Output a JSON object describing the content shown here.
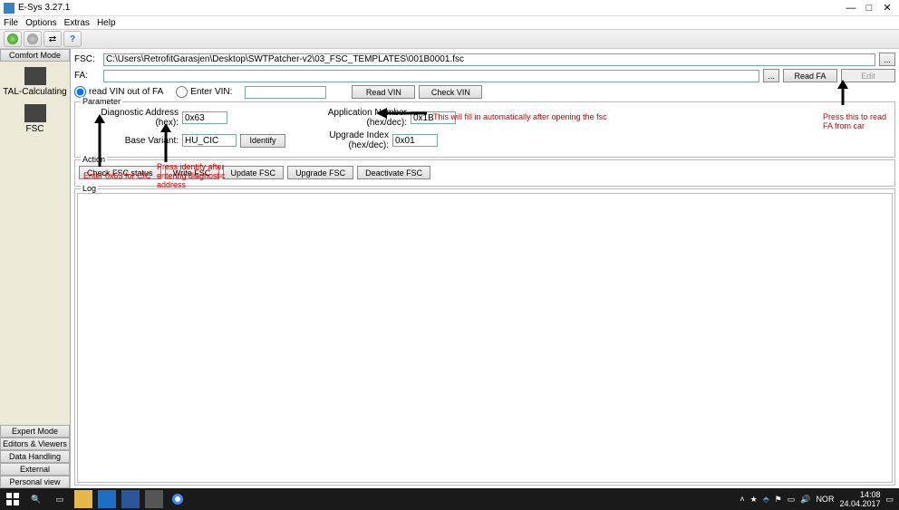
{
  "title": "E-Sys 3.27.1",
  "menubar": [
    "File",
    "Options",
    "Extras",
    "Help"
  ],
  "sidebar": {
    "top_header": "Comfort Mode",
    "items": [
      {
        "label": "TAL-Calculating"
      },
      {
        "label": "FSC"
      }
    ],
    "footer": [
      "Expert Mode",
      "Editors & Viewers",
      "Data Handling",
      "External Applications",
      "Personal view"
    ]
  },
  "fsc": {
    "label": "FSC:",
    "path": "C:\\Users\\RetrofitGarasjen\\Desktop\\SWTPatcher-v2\\03_FSC_TEMPLATES\\001B0001.fsc",
    "browse": "..."
  },
  "fa": {
    "label": "FA:",
    "value": "",
    "browse": "...",
    "read_btn": "Read FA",
    "edit_btn": "Edit"
  },
  "vin": {
    "radio_outfa": "read VIN out of FA",
    "radio_enter": "Enter VIN:",
    "enter_value": "",
    "read_btn": "Read VIN",
    "check_btn": "Check VIN"
  },
  "parameter": {
    "legend": "Parameter",
    "diag_label": "Diagnostic Address (hex):",
    "diag_value": "0x63",
    "app_label": "Application Number (hex/dec):",
    "app_value": "0x1B",
    "base_label": "Base Variant:",
    "base_value": "HU_CIC",
    "identify_btn": "Identify",
    "upgrade_label": "Upgrade Index (hex/dec):",
    "upgrade_value": "0x01"
  },
  "action": {
    "legend": "Action",
    "buttons": [
      "Check FSC status",
      "Write FSC",
      "Update FSC",
      "Upgrade FSC",
      "Deactivate FSC"
    ]
  },
  "log": {
    "legend": "Log"
  },
  "annotations": {
    "fillauto": "This will fill in automatically after opening the fsc",
    "pressread": "Press this to read FA from car",
    "enter63": "Enter 0x63 for CIC",
    "pressidentify": "Press identify after entering diagnostic address"
  },
  "taskbar": {
    "tray_text": "NOR",
    "time": "14:08",
    "date": "24.04.2017"
  }
}
